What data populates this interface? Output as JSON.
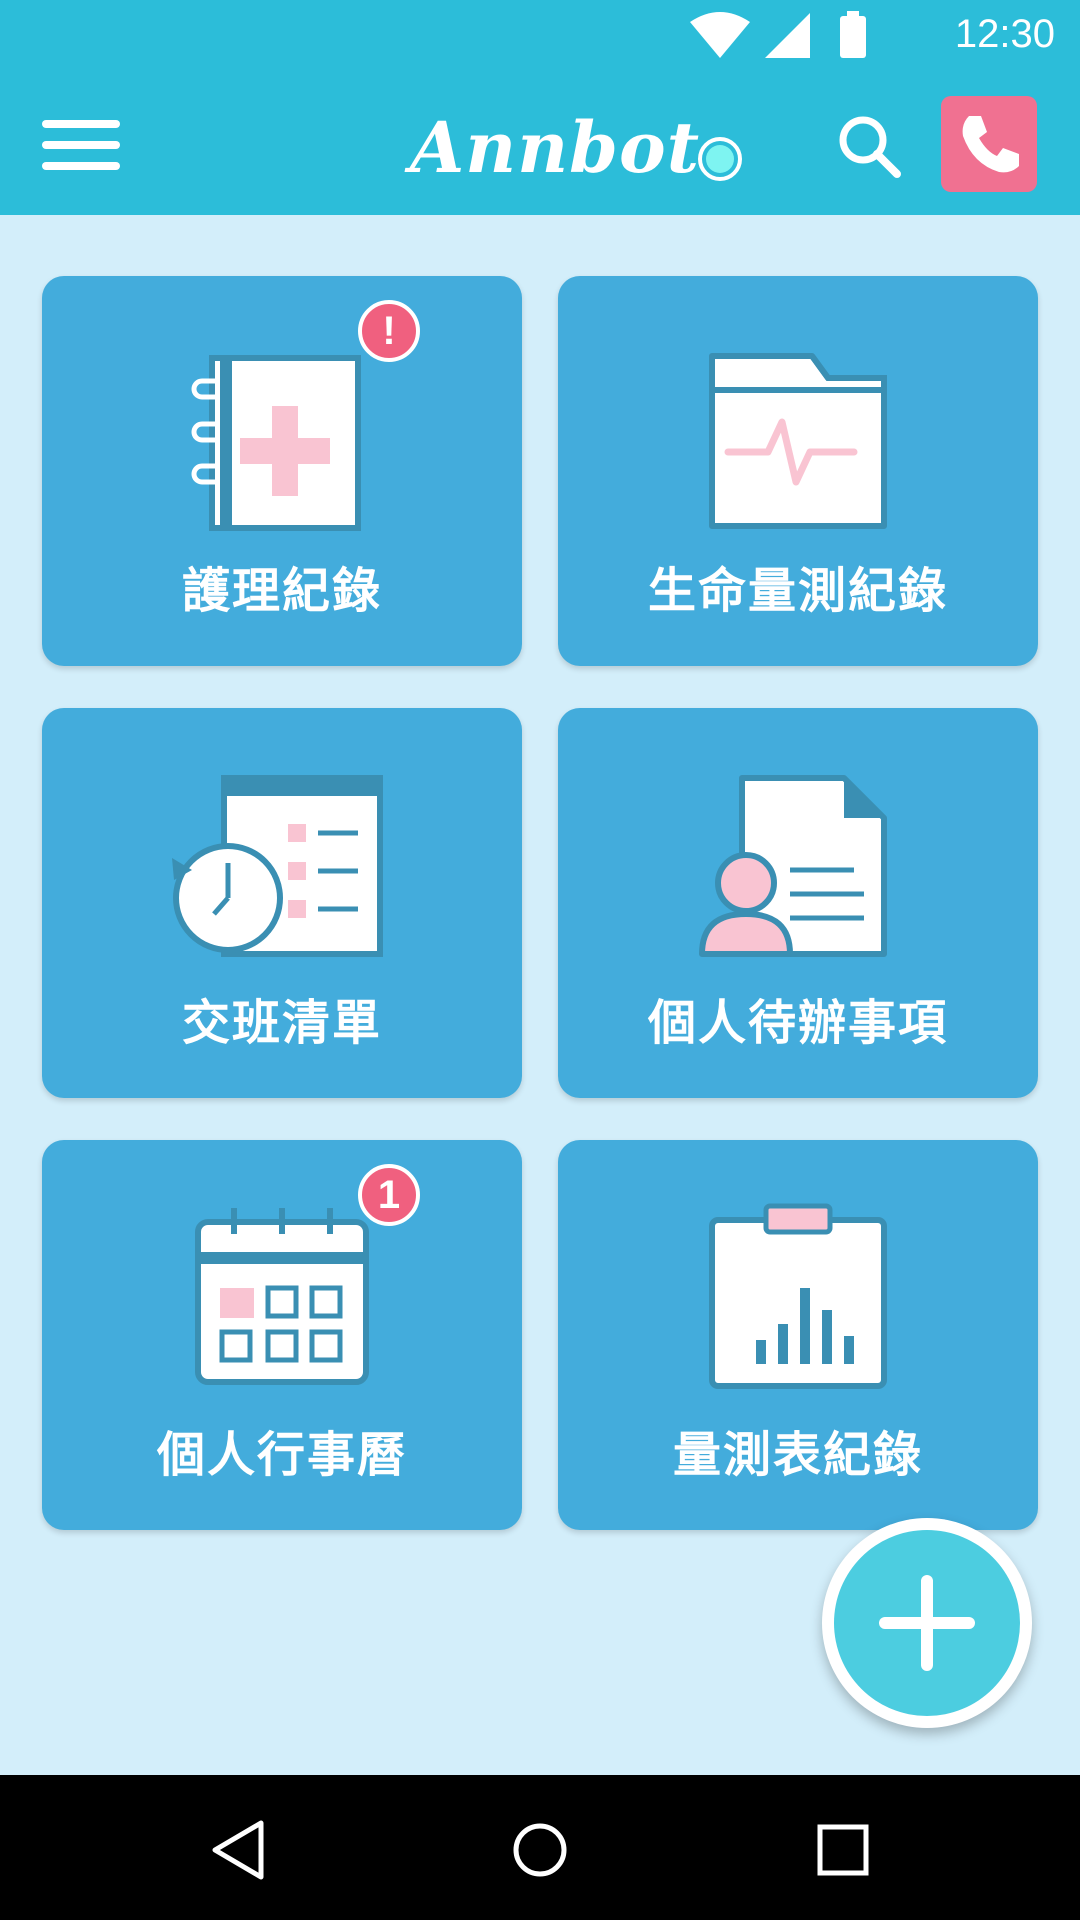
{
  "status_bar": {
    "time": "12:30",
    "icons": [
      "wifi-icon",
      "cell-signal-icon",
      "battery-icon"
    ]
  },
  "app_bar": {
    "brand": "Annbot",
    "menu_icon": "hamburger-menu-icon",
    "status_icon": "connection-status-icon",
    "search_icon": "search-icon",
    "call_icon": "phone-icon"
  },
  "tiles": [
    {
      "label": "護理紀錄",
      "icon": "nursing-record-icon",
      "badge": "!"
    },
    {
      "label": "生命量測紀錄",
      "icon": "vital-signs-folder-icon",
      "badge": ""
    },
    {
      "label": "交班清單",
      "icon": "shift-handover-list-icon",
      "badge": ""
    },
    {
      "label": "個人待辦事項",
      "icon": "personal-todo-icon",
      "badge": ""
    },
    {
      "label": "個人行事曆",
      "icon": "calendar-icon",
      "badge": "1"
    },
    {
      "label": "量測表紀錄",
      "icon": "measurement-chart-icon",
      "badge": ""
    }
  ],
  "fab": {
    "icon": "plus-icon"
  },
  "nav_bar": {
    "icons": [
      "back-icon",
      "home-icon",
      "recents-icon"
    ]
  },
  "colors": {
    "primary": "#2cbdd9",
    "background": "#d3eefa",
    "tile": "#43acdc",
    "icon_stroke": "#3a8fb3",
    "accent_pink": "#f9c4d2",
    "badge": "#f0607f",
    "call_button": "#f07191",
    "fab": "#4ccde0"
  }
}
